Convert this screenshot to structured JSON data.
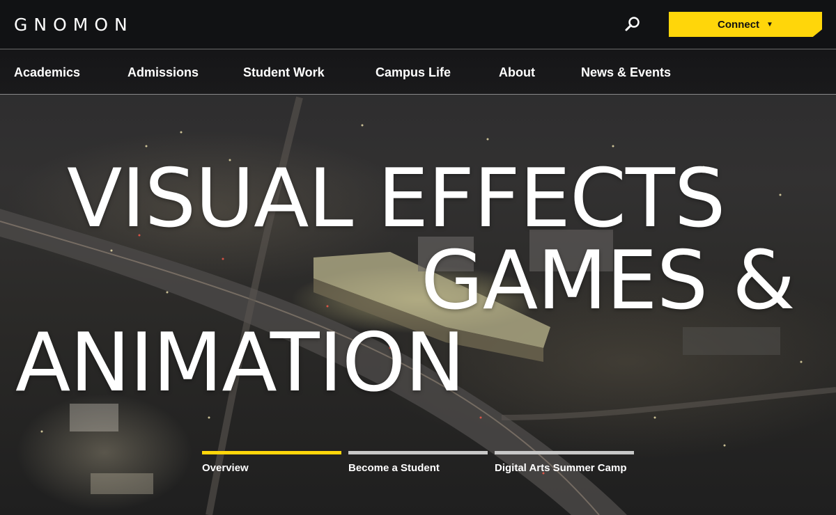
{
  "header": {
    "logo": "GNOMON",
    "connect_label": "Connect",
    "search_icon": "search-icon",
    "caret_icon": "caret-down-icon",
    "accent_color": "#ffd60a"
  },
  "nav": {
    "items": [
      {
        "label": "Academics"
      },
      {
        "label": "Admissions"
      },
      {
        "label": "Student Work"
      },
      {
        "label": "Campus Life"
      },
      {
        "label": "About"
      },
      {
        "label": "News & Events"
      }
    ]
  },
  "hero": {
    "lines": [
      "VISUAL EFFECTS",
      "GAMES &",
      "ANIMATION"
    ]
  },
  "tabs": [
    {
      "label": "Overview",
      "active": true
    },
    {
      "label": "Become a Student",
      "active": false
    },
    {
      "label": "Digital Arts Summer Camp",
      "active": false
    }
  ]
}
